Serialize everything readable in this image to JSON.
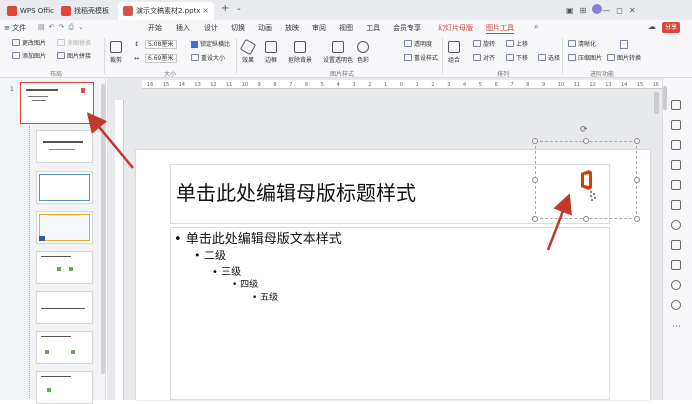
{
  "titlebar": {
    "tabs": [
      {
        "label": "WPS Office"
      },
      {
        "label": "找稻壳模板"
      },
      {
        "label": "演示文稿素材2.pptx"
      }
    ],
    "add_tab": "+"
  },
  "menubar": {
    "file": "≡ 文件",
    "items": [
      "开始",
      "插入",
      "设计",
      "切换",
      "动画",
      "放映",
      "审阅",
      "视图",
      "工具",
      "会员专享",
      "幻灯片母版",
      "图片工具"
    ],
    "share": "分享"
  },
  "ribbon": {
    "change_pic": "更改图片",
    "multi_replace": "多图替换",
    "add_pic": "添加图片",
    "pic_combine": "图片拼接",
    "group_layout": "布局",
    "crop": "裁剪",
    "height_value": "5.08厘米",
    "width_value": "6.69厘米",
    "lock_ratio": "锁定纵横比",
    "reset_size": "重设大小",
    "group_size": "大小",
    "effects": "效果",
    "border": "边框",
    "matting": "抠除背景",
    "set_transparent": "设置透明色",
    "color": "色彩",
    "transparency": "透明度",
    "reset_style": "重设样式",
    "group_style": "图片样式",
    "combine": "组合",
    "rotate": "旋转",
    "align": "对齐",
    "move_up": "上移",
    "move_down": "下移",
    "select": "选择",
    "group_arrange": "排列",
    "sharpen": "清晰化",
    "compress": "压缩图片",
    "convert": "图片转换",
    "group_advanced": "进阶功能"
  },
  "slide_panel": {
    "numbers": [
      "1"
    ]
  },
  "ruler_labels": [
    "16",
    "15",
    "14",
    "13",
    "12",
    "11",
    "10",
    "9",
    "8",
    "7",
    "6",
    "5",
    "4",
    "3",
    "2",
    "1",
    "0",
    "1",
    "2",
    "3",
    "4",
    "5",
    "6",
    "7",
    "8",
    "9",
    "10",
    "11",
    "12",
    "13",
    "14",
    "15",
    "16"
  ],
  "slide": {
    "title": "单击此处编辑母版标题样式",
    "levels": [
      "• 单击此处编辑母版文本样式",
      "• 二级",
      "• 三级",
      "• 四级",
      "• 五级"
    ]
  },
  "colors": {
    "accent_red": "#c94231",
    "selected_tab": "#ffffff",
    "ribbon_active": "#d9534f",
    "arrow": "#c0392b"
  }
}
